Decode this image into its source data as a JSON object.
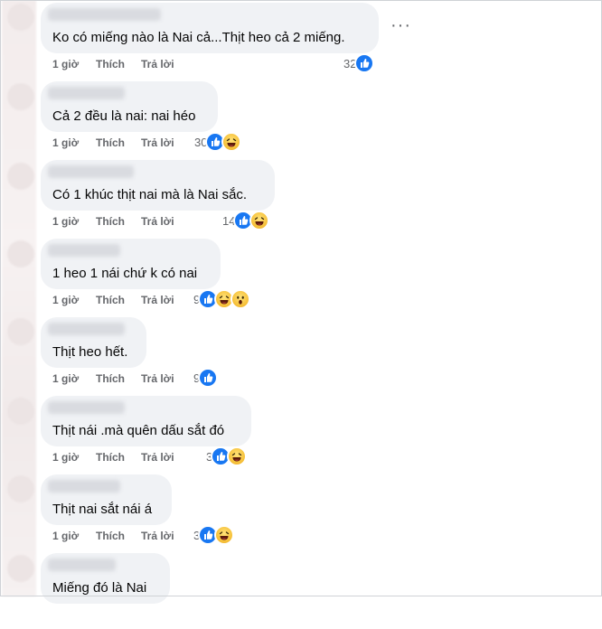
{
  "actions": {
    "time": "1 giờ",
    "like": "Thích",
    "reply": "Trả lời"
  },
  "more_label": "···",
  "comments": [
    {
      "text": "Ko có miếng nào là Nai cả...Thịt heo cả 2 miếng.",
      "count": "32",
      "reactions": [
        "like"
      ]
    },
    {
      "text": "Cả 2 đều là nai: nai héo",
      "count": "30",
      "reactions": [
        "like",
        "haha"
      ]
    },
    {
      "text": "Có 1 khúc thịt nai mà là Nai sắc.",
      "count": "14",
      "reactions": [
        "like",
        "haha"
      ]
    },
    {
      "text": "1 heo 1 nái chứ k có nai",
      "count": "9",
      "reactions": [
        "like",
        "haha",
        "wow"
      ]
    },
    {
      "text": "Thịt heo hết.",
      "count": "9",
      "reactions": [
        "like"
      ]
    },
    {
      "text": "Thịt nái .mà quên dấu sắt đó",
      "count": "3",
      "reactions": [
        "like",
        "haha"
      ]
    },
    {
      "text": "Thịt nai sắt nái á",
      "count": "3",
      "reactions": [
        "like",
        "haha"
      ]
    },
    {
      "text": "Miếng đó là Nai",
      "count": "",
      "reactions": []
    }
  ],
  "colors": {
    "like": "#1877f2",
    "bubble": "#f0f2f5",
    "meta": "#65676b"
  },
  "icons": {
    "like": "thumbs-up-icon",
    "haha": "laughing-face-icon",
    "wow": "surprised-face-icon"
  }
}
